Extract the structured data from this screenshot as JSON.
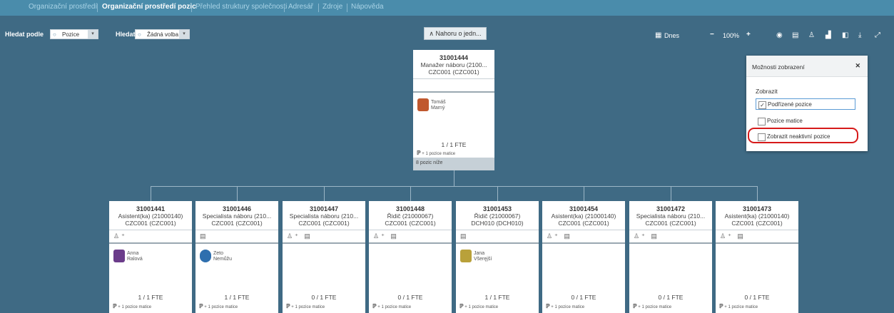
{
  "nav": {
    "tabs": [
      "Organizační prostředí",
      "Organizační prostředí pozic",
      "Přehled struktury společnosti",
      "Adresář",
      "Zdroje",
      "Nápověda"
    ],
    "active": 1
  },
  "toolbar": {
    "search_by_label": "Hledat podle",
    "search_by_value": "Pozice",
    "search_label": "Hledat",
    "search_value": "Žádná volba",
    "up_button": "Nahoru o jedn...",
    "date_label": "Dnes",
    "zoom_out": "−",
    "zoom_level": "100%",
    "zoom_in": "+"
  },
  "root": {
    "code": "31001444",
    "title": "Manažer náboru (2100...",
    "org": "CZC001 (CZC001)",
    "person_first": "Tomáš",
    "person_last": "Marný",
    "fte": "1 / 1 FTE",
    "matrix": "+ 1 pozice matice",
    "below": "8 pozic níže"
  },
  "children": [
    {
      "code": "31001441",
      "title": "Asistent(ka) (21000140)",
      "org": "CZC001 (CZC001)",
      "first": "Anna",
      "last": "Ralová",
      "fte": "1 / 1 FTE",
      "matrix": "+ 1 pozice matice"
    },
    {
      "code": "31001446",
      "title": "Specialista náboru (210...",
      "org": "CZC001 (CZC001)",
      "first": "Zeto",
      "last": "Nemůžu",
      "fte": "1 / 1 FTE",
      "matrix": "+ 1 pozice matice"
    },
    {
      "code": "31001447",
      "title": "Specialista náboru (210...",
      "org": "CZC001 (CZC001)",
      "first": "",
      "last": "",
      "fte": "0 / 1 FTE",
      "matrix": "+ 1 pozice matice"
    },
    {
      "code": "31001448",
      "title": "Řidič (21000067)",
      "org": "CZC001 (CZC001)",
      "first": "",
      "last": "",
      "fte": "0 / 1 FTE",
      "matrix": "+ 1 pozice matice"
    },
    {
      "code": "31001453",
      "title": "Řidič (21000067)",
      "org": "DCH010 (DCH010)",
      "first": "Jana",
      "last": "Všeręjší",
      "fte": "1 / 1 FTE",
      "matrix": "+ 1 pozice matice"
    },
    {
      "code": "31001454",
      "title": "Asistent(ka) (21000140)",
      "org": "CZC001 (CZC001)",
      "first": "",
      "last": "",
      "fte": "0 / 1 FTE",
      "matrix": "+ 1 pozice matice"
    },
    {
      "code": "31001472",
      "title": "Specialista náboru (210...",
      "org": "CZC001 (CZC001)",
      "first": "",
      "last": "",
      "fte": "0 / 1 FTE",
      "matrix": "+ 1 pozice matice"
    },
    {
      "code": "31001473",
      "title": "Asistent(ka) (21000140)",
      "org": "CZC001 (CZC001)",
      "first": "",
      "last": "",
      "fte": "0 / 1 FTE",
      "matrix": "+ 1 pozice matice"
    }
  ],
  "panel": {
    "title": "Možnosti zobrazení",
    "section": "Zobrazit",
    "options": [
      {
        "label": "Podřízené pozice",
        "checked": true
      },
      {
        "label": "Pozice matice",
        "checked": false
      },
      {
        "label": "Zobrazit neaktivní pozice",
        "checked": false
      }
    ]
  },
  "colors": {
    "background": "#3f6a84",
    "nav": "#4a8cab",
    "highlight": "#d61a1a"
  }
}
